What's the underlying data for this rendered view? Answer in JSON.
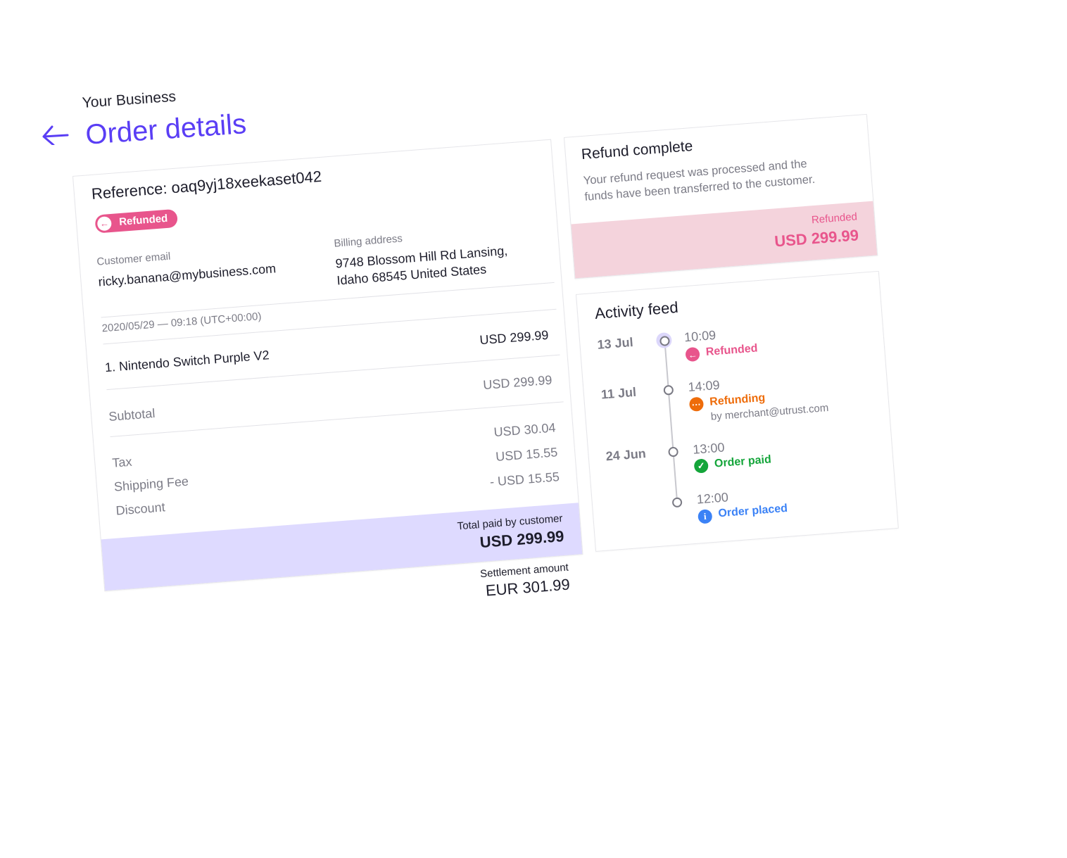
{
  "header": {
    "business": "Your Business",
    "title": "Order details",
    "back_icon": "arrow-left-icon"
  },
  "order": {
    "reference_label": "Reference:",
    "reference": "oaq9yj18xeekaset042",
    "status": "Refunded",
    "customer_email_label": "Customer email",
    "customer_email": "ricky.banana@mybusiness.com",
    "billing_label": "Billing address",
    "billing_line1": "9748 Blossom Hill Rd Lansing,",
    "billing_line2": "Idaho 68545 United States",
    "date": "2020/05/29 — 09:18 (UTC+00:00)",
    "item": "1. Nintendo Switch Purple V2",
    "item_price": "USD 299.99",
    "subtotal_label": "Subtotal",
    "subtotal": "USD 299.99",
    "tax_label": "Tax",
    "tax": "USD 30.04",
    "shipping_label": "Shipping Fee",
    "shipping": "USD 15.55",
    "discount_label": "Discount",
    "discount": "- USD 15.55",
    "total_label": "Total paid by customer",
    "total": "USD 299.99",
    "settlement_label": "Settlement amount",
    "settlement": "EUR 301.99"
  },
  "refund": {
    "title": "Refund complete",
    "body_line1": "Your refund request was processed and the",
    "body_line2": "funds have been transferred to the customer.",
    "status": "Refunded",
    "amount": "USD 299.99"
  },
  "activity": {
    "title": "Activity feed",
    "events": [
      {
        "date": "13 Jul",
        "time": "10:09",
        "label": "Refunded",
        "icon": "arrow-left-icon",
        "color": "#e8558c"
      },
      {
        "date": "11 Jul",
        "time": "14:09",
        "label": "Refunding",
        "sub": "by merchant@utrust.com",
        "icon": "ellipsis-icon",
        "color": "#ee6c0a"
      },
      {
        "date": "24 Jun",
        "time": "13:00",
        "label": "Order paid",
        "icon": "check-icon",
        "color": "#14a53a"
      },
      {
        "date": "",
        "time": "12:00",
        "label": "Order placed",
        "icon": "info-icon",
        "color": "#3b82f6"
      }
    ]
  },
  "colors": {
    "accent": "#5a3ef5",
    "total_band": "#dedaff",
    "refund_band": "#f4d3dc",
    "pink": "#e8558c"
  }
}
